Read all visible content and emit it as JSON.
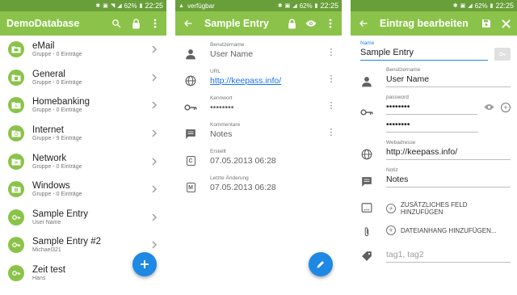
{
  "colors": {
    "primary": "#8bc34a",
    "primary_dark": "#689f38",
    "fab": "#1e88e5",
    "link": "#1a73e8"
  },
  "status_bar": {
    "battery": "62%",
    "time": "22:25",
    "notice": "verfügbar"
  },
  "screen1": {
    "title": "DemoDatabase",
    "items": [
      {
        "title": "eMail",
        "subtitle": "Gruppe - 0 Einträge",
        "icon": "folder-mail-icon"
      },
      {
        "title": "General",
        "subtitle": "Gruppe - 0 Einträge",
        "icon": "folder-general-icon"
      },
      {
        "title": "Homebanking",
        "subtitle": "Gruppe - 0 Einträge",
        "icon": "folder-percent-icon"
      },
      {
        "title": "Internet",
        "subtitle": "Gruppe - 9 Einträge",
        "icon": "folder-globe-icon"
      },
      {
        "title": "Network",
        "subtitle": "Gruppe - 0 Einträge",
        "icon": "folder-network-icon"
      },
      {
        "title": "Windows",
        "subtitle": "Gruppe - 0 Einträge",
        "icon": "folder-windows-icon"
      },
      {
        "title": "Sample Entry",
        "subtitle": "User Name",
        "icon": "key-icon"
      },
      {
        "title": "Sample Entry #2",
        "subtitle": "Michael321",
        "icon": "key-icon"
      },
      {
        "title": "Zeit test",
        "subtitle": "Hans",
        "icon": "key-icon"
      }
    ]
  },
  "screen2": {
    "title": "Sample Entry",
    "fields": [
      {
        "label": "Benutzername",
        "value": "User Name"
      },
      {
        "label": "URL",
        "value": "http://keepass.info/"
      },
      {
        "label": "Kennwort",
        "value": "••••••••"
      },
      {
        "label": "Kommentare",
        "value": "Notes"
      },
      {
        "label": "Erstellt",
        "value": "07.05.2013 06:28",
        "icon_text": "C"
      },
      {
        "label": "Letzte Änderung",
        "value": "07.05.2013 06:28",
        "icon_text": "M"
      }
    ]
  },
  "screen3": {
    "title": "Eintrag bearbeiten",
    "name_label": "Name",
    "name_value": "Sample Entry",
    "username_label": "Benutzername",
    "username_value": "User Name",
    "password_label": "password",
    "password_value": "••••••••",
    "password_repeat": "••••••••",
    "url_label": "Webadresse",
    "url_value": "http://keepass.info/",
    "notes_label": "Notiz",
    "notes_value": "Notes",
    "add_field_label": "ZUSÄTZLICHES FELD HINZUFÜGEN",
    "add_attachment_label": "DATEIANHANG HINZUFÜGEN...",
    "tags_placeholder": "tag1, tag2"
  }
}
